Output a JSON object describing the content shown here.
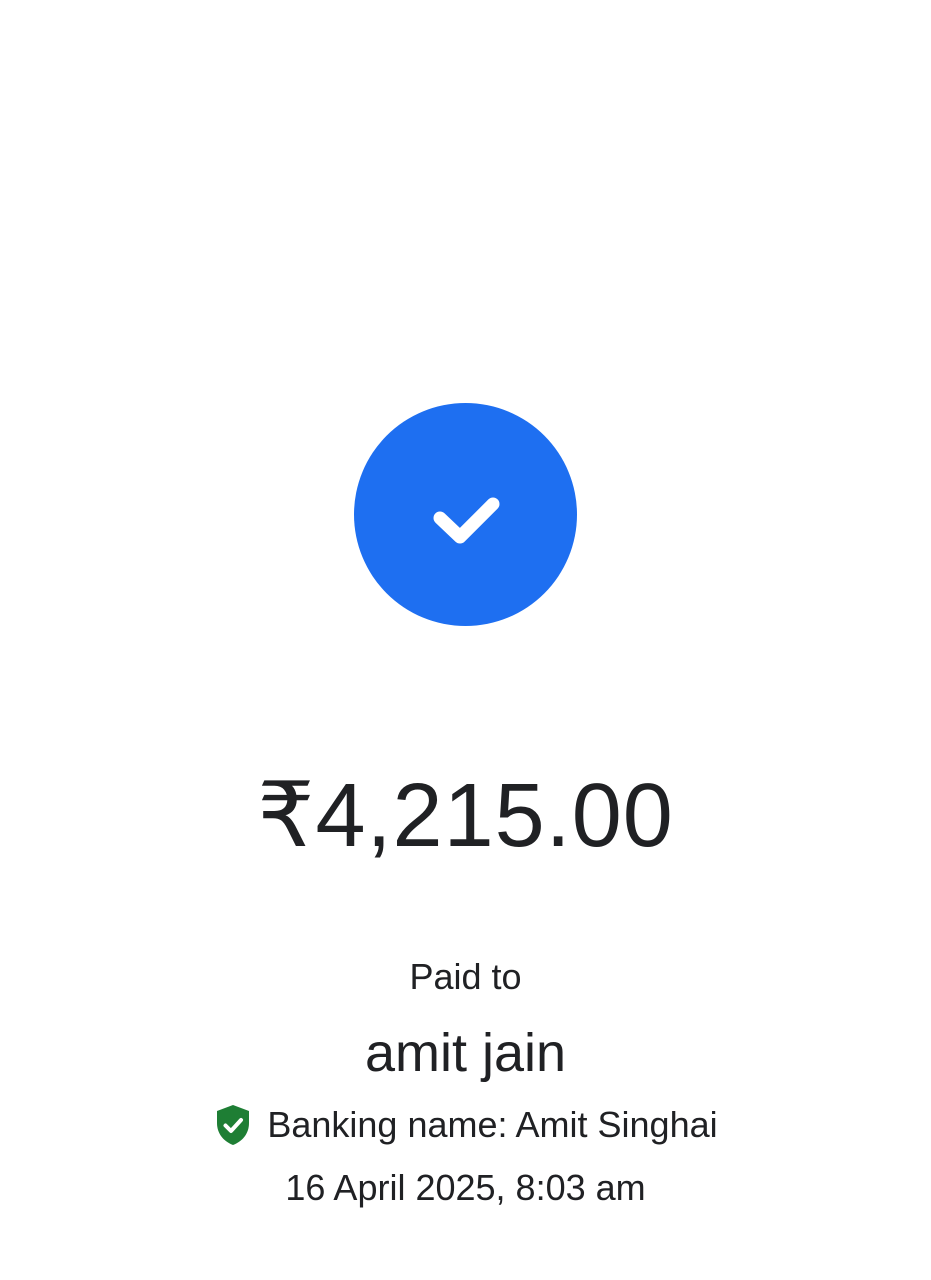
{
  "payment": {
    "status_icon": "check-icon",
    "status_color": "#1e6ff1",
    "amount": "₹4,215.00",
    "paid_to_label": "Paid to",
    "payee_name": "amit jain",
    "verified_icon": "verified-shield-icon",
    "verified_color": "#1e7e34",
    "banking_name": "Banking name: Amit Singhai",
    "timestamp": "16 April 2025, 8:03 am"
  }
}
